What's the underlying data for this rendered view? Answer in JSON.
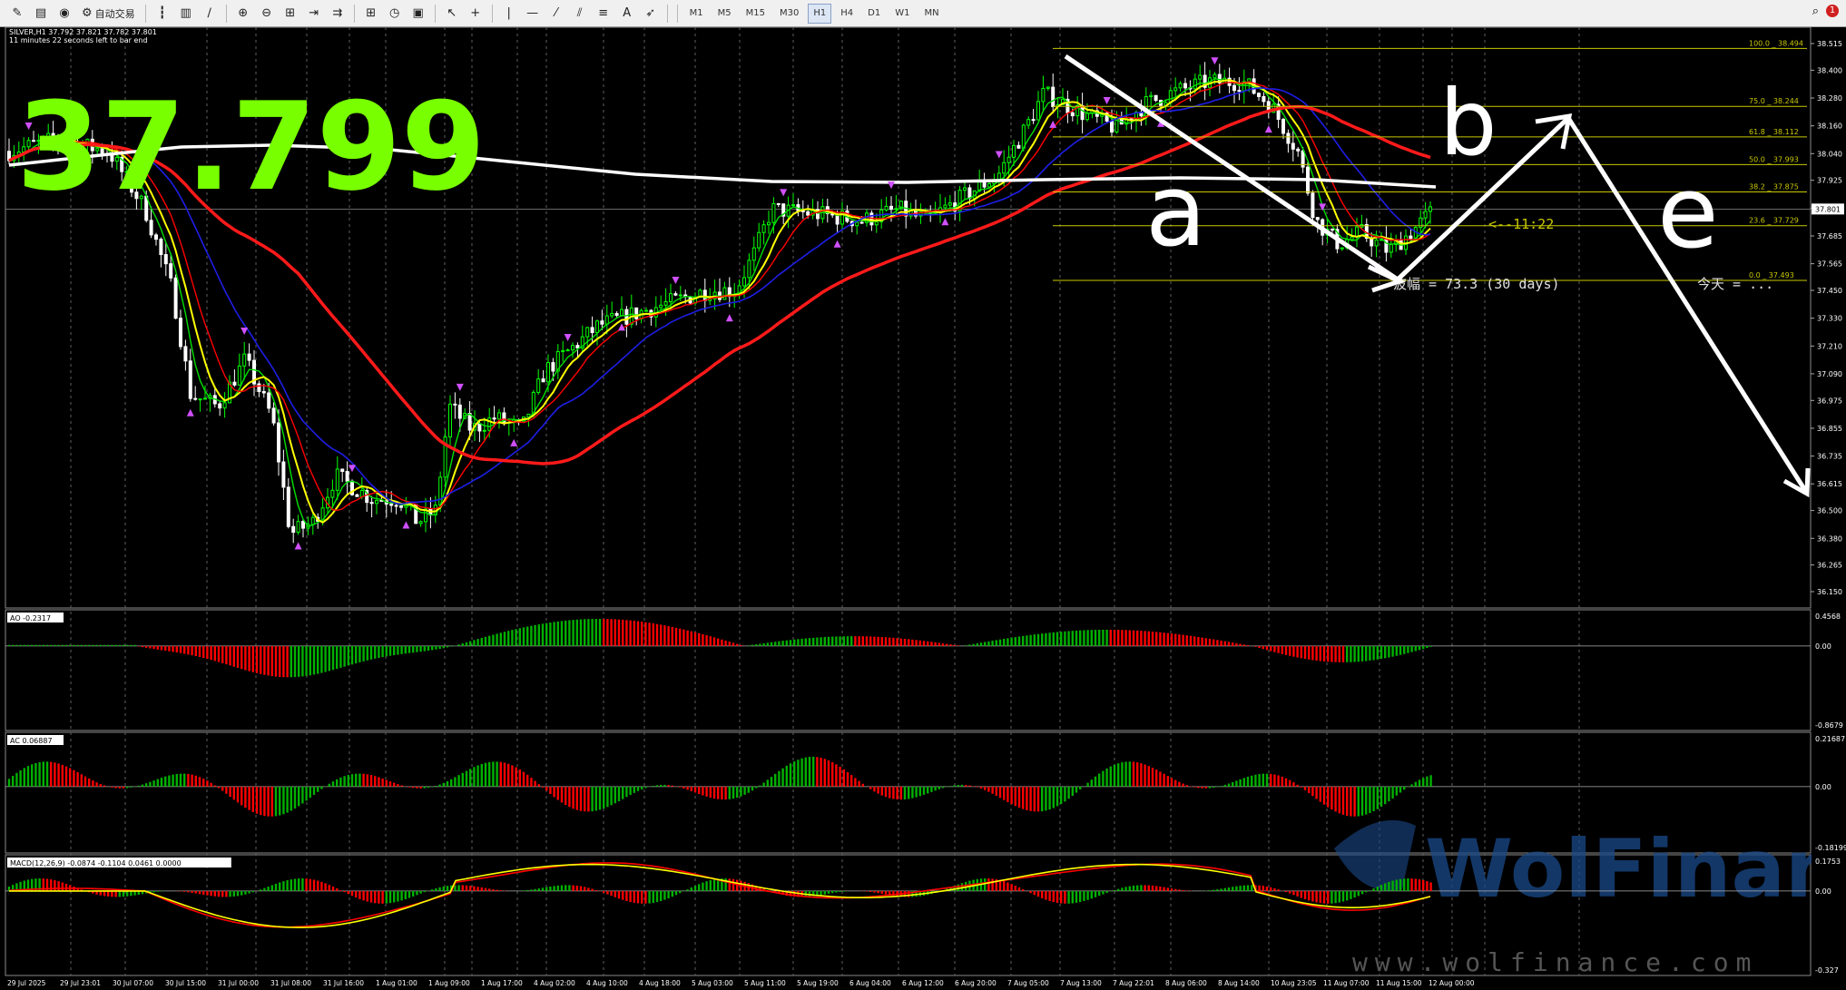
{
  "toolbar": {
    "buttons": [
      {
        "name": "new-order-icon",
        "glyph": "✎"
      },
      {
        "name": "market-watch-icon",
        "glyph": "▤"
      },
      {
        "name": "navigator-icon",
        "glyph": "◉"
      },
      {
        "name": "autotrading-button",
        "glyph": "⚙",
        "label": "自动交易"
      },
      {
        "name": "bar-chart-icon",
        "glyph": "┇"
      },
      {
        "name": "candles-icon",
        "glyph": "▥"
      },
      {
        "name": "line-chart-icon",
        "glyph": "∕"
      },
      {
        "name": "zoom-in-icon",
        "glyph": "⊕"
      },
      {
        "name": "zoom-out-icon",
        "glyph": "⊖"
      },
      {
        "name": "tile-windows-icon",
        "glyph": "⊞"
      },
      {
        "name": "chart-shift-icon",
        "glyph": "⇥"
      },
      {
        "name": "autoscroll-icon",
        "glyph": "⇉"
      },
      {
        "name": "indicators-icon",
        "glyph": "⊞"
      },
      {
        "name": "periods-icon",
        "glyph": "◷"
      },
      {
        "name": "templates-icon",
        "glyph": "▣"
      },
      {
        "name": "cursor-icon",
        "glyph": "↖"
      },
      {
        "name": "crosshair-icon",
        "glyph": "+"
      },
      {
        "name": "vertical-line-icon",
        "glyph": "|"
      },
      {
        "name": "horizontal-line-icon",
        "glyph": "—"
      },
      {
        "name": "trendline-icon",
        "glyph": "⁄"
      },
      {
        "name": "equidistant-channel-icon",
        "glyph": "⫽"
      },
      {
        "name": "fibonacci-icon",
        "glyph": "≡"
      },
      {
        "name": "text-icon",
        "glyph": "A"
      },
      {
        "name": "arrows-icon",
        "glyph": "➶"
      }
    ],
    "timeframes": [
      "M1",
      "M5",
      "M15",
      "M30",
      "H1",
      "H4",
      "D1",
      "W1",
      "MN"
    ],
    "active_timeframe": "H1",
    "right_icons": [
      "search-icon",
      "alerts-icon"
    ]
  },
  "chart": {
    "header_line1": "SILVER,H1  37.792 37.821 37.782 37.801",
    "header_line2": "11 minutes 22 seconds left to bar end",
    "big_price": "37.799",
    "current_price_tag": "37.801",
    "countdown_label": "<--11:22",
    "range_label": "波幅 = 73.3  (30 days)",
    "today_label": "今天 = ...",
    "wave_labels": [
      "a",
      "b",
      "e"
    ],
    "watermark_brand": "WolFinance",
    "watermark_url": "www.wolfinance.com",
    "colors": {
      "bull_candle": "#00ff00",
      "bear_candle": "#ffffff",
      "ma_red": "#ff0000",
      "ma_thick_red": "#ff1a1a",
      "ma_yellow": "#ffff00",
      "ma_green": "#00e000",
      "ma_blue": "#1e1ee6",
      "ma_white": "#ffffff",
      "fractal": "#d050ff",
      "fib": "#c8c800",
      "ao_up": "#00b000",
      "ao_down": "#ff0000",
      "macd_signal": "#ffff00",
      "macd_main": "#ff0000",
      "big_price": "#78ff00",
      "grid": "#606060"
    },
    "price_axis": [
      "38.515",
      "38.400",
      "38.280",
      "38.160",
      "38.040",
      "37.925",
      "37.805",
      "37.685",
      "37.565",
      "37.450",
      "37.330",
      "37.210",
      "37.090",
      "36.975",
      "36.855",
      "36.735",
      "36.615",
      "36.500",
      "36.380",
      "36.265",
      "36.150"
    ],
    "time_axis": [
      "29 Jul 2025",
      "29 Jul 23:01",
      "30 Jul 07:00",
      "30 Jul 15:00",
      "31 Jul 00:00",
      "31 Jul 08:00",
      "31 Jul 16:00",
      "1 Aug 01:00",
      "1 Aug 09:00",
      "1 Aug 17:00",
      "4 Aug 02:00",
      "4 Aug 10:00",
      "4 Aug 18:00",
      "5 Aug 03:00",
      "5 Aug 11:00",
      "5 Aug 19:00",
      "6 Aug 04:00",
      "6 Aug 12:00",
      "6 Aug 20:00",
      "7 Aug 05:00",
      "7 Aug 13:00",
      "7 Aug 22:01",
      "8 Aug 06:00",
      "8 Aug 14:00",
      "10 Aug 23:05",
      "11 Aug 07:00",
      "11 Aug 15:00",
      "12 Aug 00:00"
    ],
    "fib_levels": [
      {
        "label": "100.0",
        "price": "38.494"
      },
      {
        "label": "75.0",
        "price": "38.244"
      },
      {
        "label": "61.8",
        "price": "38.112"
      },
      {
        "label": "50.0",
        "price": "37.993"
      },
      {
        "label": "38.2",
        "price": "37.875"
      },
      {
        "label": "23.6",
        "price": "37.729"
      },
      {
        "label": "0.0",
        "price": "37.493"
      }
    ],
    "ao": {
      "label": "AO -0.2317",
      "axis": [
        "0.4568",
        "0.00",
        "-0.8679"
      ]
    },
    "ac": {
      "label": "AC 0.06887",
      "axis": [
        "0.21687",
        "0.00",
        "-0.18199"
      ]
    },
    "macd": {
      "label": "MACD(12,26,9) -0.0874 -0.1104 0.0461 0.0000",
      "axis": [
        "0.1753",
        "0.00",
        "-0.327"
      ]
    }
  },
  "chart_data": {
    "type": "line",
    "title": "SILVER,H1",
    "series": [
      {
        "name": "SILVER H1 close",
        "x": [
          "29 Jul 2025",
          "30 Jul 07:00",
          "30 Jul 15:00",
          "31 Jul 08:00",
          "1 Aug 01:00",
          "1 Aug 09:00",
          "4 Aug 10:00",
          "5 Aug 11:00",
          "6 Aug 04:00",
          "7 Aug 05:00",
          "7 Aug 22:01",
          "8 Aug 14:00",
          "11 Aug 07:00",
          "12 Aug 00:00"
        ],
        "values": [
          38.05,
          38.1,
          37.4,
          36.7,
          36.6,
          36.75,
          37.15,
          37.6,
          37.77,
          38.0,
          38.3,
          38.25,
          37.55,
          37.8
        ]
      }
    ],
    "ylim": [
      36.15,
      38.515
    ]
  }
}
